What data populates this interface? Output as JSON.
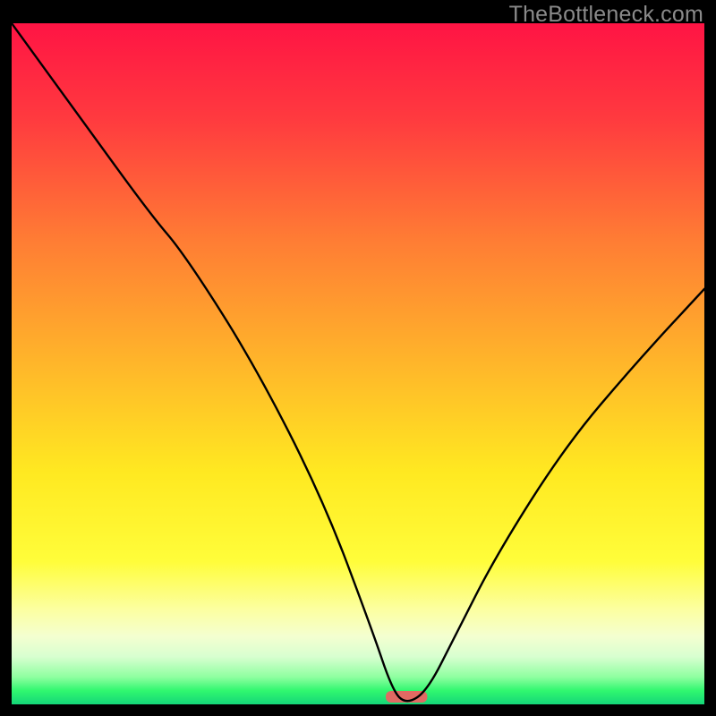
{
  "watermark": "TheBottleneck.com",
  "chart_data": {
    "type": "line",
    "title": "",
    "xlabel": "",
    "ylabel": "",
    "xlim": [
      0,
      100
    ],
    "ylim": [
      0,
      100
    ],
    "series": [
      {
        "name": "bottleneck-curve",
        "x": [
          0,
          10,
          20,
          25,
          35,
          45,
          52,
          55,
          57,
          60,
          64,
          70,
          80,
          90,
          100
        ],
        "values": [
          100,
          86,
          72,
          66,
          50,
          30,
          11,
          2,
          0,
          2,
          10,
          22,
          38,
          50,
          61
        ]
      }
    ],
    "marker": {
      "name": "optimal-marker",
      "x": 57,
      "width_pct": 6.0,
      "color": "#e16a63"
    },
    "gradient_stops": [
      {
        "pct": 0,
        "color": "#ff1444"
      },
      {
        "pct": 14,
        "color": "#ff3a3f"
      },
      {
        "pct": 32,
        "color": "#ff7d34"
      },
      {
        "pct": 50,
        "color": "#ffb62a"
      },
      {
        "pct": 66,
        "color": "#ffe921"
      },
      {
        "pct": 79,
        "color": "#fffd3a"
      },
      {
        "pct": 86,
        "color": "#fcffa0"
      },
      {
        "pct": 90,
        "color": "#f4ffd0"
      },
      {
        "pct": 93,
        "color": "#d8ffd0"
      },
      {
        "pct": 96,
        "color": "#8effa0"
      },
      {
        "pct": 98,
        "color": "#30f76f"
      },
      {
        "pct": 100,
        "color": "#14d678"
      }
    ]
  }
}
